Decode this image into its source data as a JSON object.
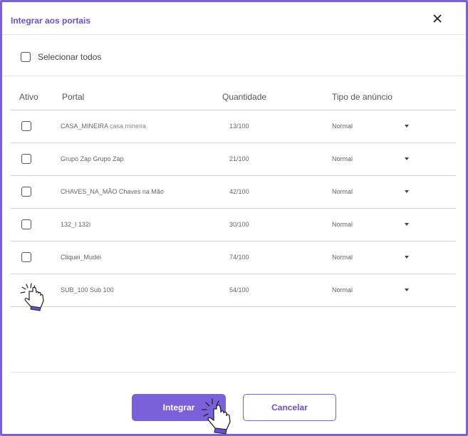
{
  "header": {
    "title": "Integrar aos portais",
    "close_icon": "close-icon"
  },
  "select_all": {
    "label": "Selecionar todos",
    "checked": false
  },
  "table": {
    "columns": {
      "ativo": "Ativo",
      "portal": "Portal",
      "quantidade": "Quantidade",
      "tipo": "Tipo de anúncio"
    },
    "rows": [
      {
        "code": "CASA_MINEIRA",
        "name": "casa mineira",
        "quantidade": "13/100",
        "tipo": "Normal"
      },
      {
        "code": "Grupo Zap",
        "name": "Grupo Zap",
        "quantidade": "21/100",
        "tipo": "Normal"
      },
      {
        "code": "CHAVES_NA_MÃO",
        "name": "Chaves na Mão",
        "quantidade": "42/100",
        "tipo": "Normal"
      },
      {
        "code": "132_I",
        "name": "132i",
        "quantidade": "30/100",
        "tipo": "Normal"
      },
      {
        "code": "Cliquei_Mudei",
        "name": "",
        "quantidade": "74/100",
        "tipo": "Normal"
      },
      {
        "code": "SUB_100",
        "name": "Sub 100",
        "quantidade": "54/100",
        "tipo": "Normal"
      }
    ]
  },
  "footer": {
    "primary_label": "Integrar",
    "secondary_label": "Cancelar"
  },
  "colors": {
    "accent": "#7b61d9",
    "title": "#6c4fd6"
  }
}
